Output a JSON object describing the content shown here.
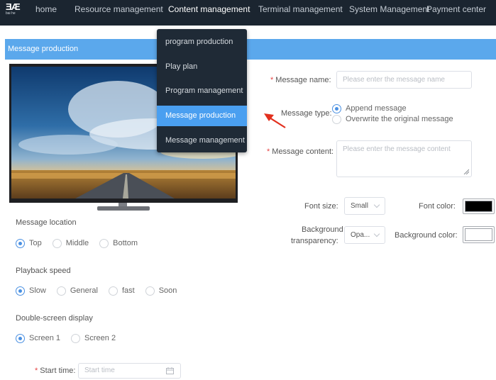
{
  "logo": {
    "mark": "ƎÆ",
    "sub": "bai he"
  },
  "nav": {
    "items": [
      {
        "label": "home"
      },
      {
        "label": "Resource management"
      },
      {
        "label": "Content management"
      },
      {
        "label": "Terminal management"
      },
      {
        "label": "System Management"
      },
      {
        "label": "Payment center"
      }
    ]
  },
  "section": {
    "title": "Message production"
  },
  "dropdown": {
    "items": [
      {
        "label": "program production"
      },
      {
        "label": "Play plan"
      },
      {
        "label": "Program management"
      },
      {
        "label": "Message production"
      },
      {
        "label": "Message management"
      }
    ],
    "active": "Message production"
  },
  "left": {
    "location": {
      "label": "Message location",
      "options": [
        "Top",
        "Middle",
        "Bottom"
      ],
      "selected": "Top"
    },
    "speed": {
      "label": "Playback speed",
      "options": [
        "Slow",
        "General",
        "fast",
        "Soon"
      ],
      "selected": "Slow"
    },
    "screen": {
      "label": "Double-screen display",
      "options": [
        "Screen 1",
        "Screen 2"
      ],
      "selected": "Screen 1"
    },
    "start_time": {
      "label": "Start time:",
      "placeholder": "Start time"
    }
  },
  "form": {
    "name": {
      "label": "Message name:",
      "placeholder": "Please enter the message name"
    },
    "type": {
      "label": "Message type:",
      "options": [
        "Append message",
        "Overwrite the original message"
      ],
      "selected": "Append message"
    },
    "content": {
      "label": "Message content:",
      "placeholder": "Please enter the message content"
    },
    "font_size": {
      "label": "Font size:",
      "value": "Small"
    },
    "font_color": {
      "label": "Font color:",
      "value": "#000000"
    },
    "bg_transparency": {
      "label_line1": "Background",
      "label_line2": "transparency:",
      "value": "Opa..."
    },
    "bg_color": {
      "label": "Background color:",
      "value": "#ffffff"
    }
  },
  "icons": {
    "calendar": "calendar-icon",
    "caret": "chevron-down-icon"
  },
  "colors": {
    "nav_bg": "#1b2530",
    "section_bar": "#5ba8ec",
    "accent": "#4a90e2",
    "arrow": "#e2301e"
  }
}
